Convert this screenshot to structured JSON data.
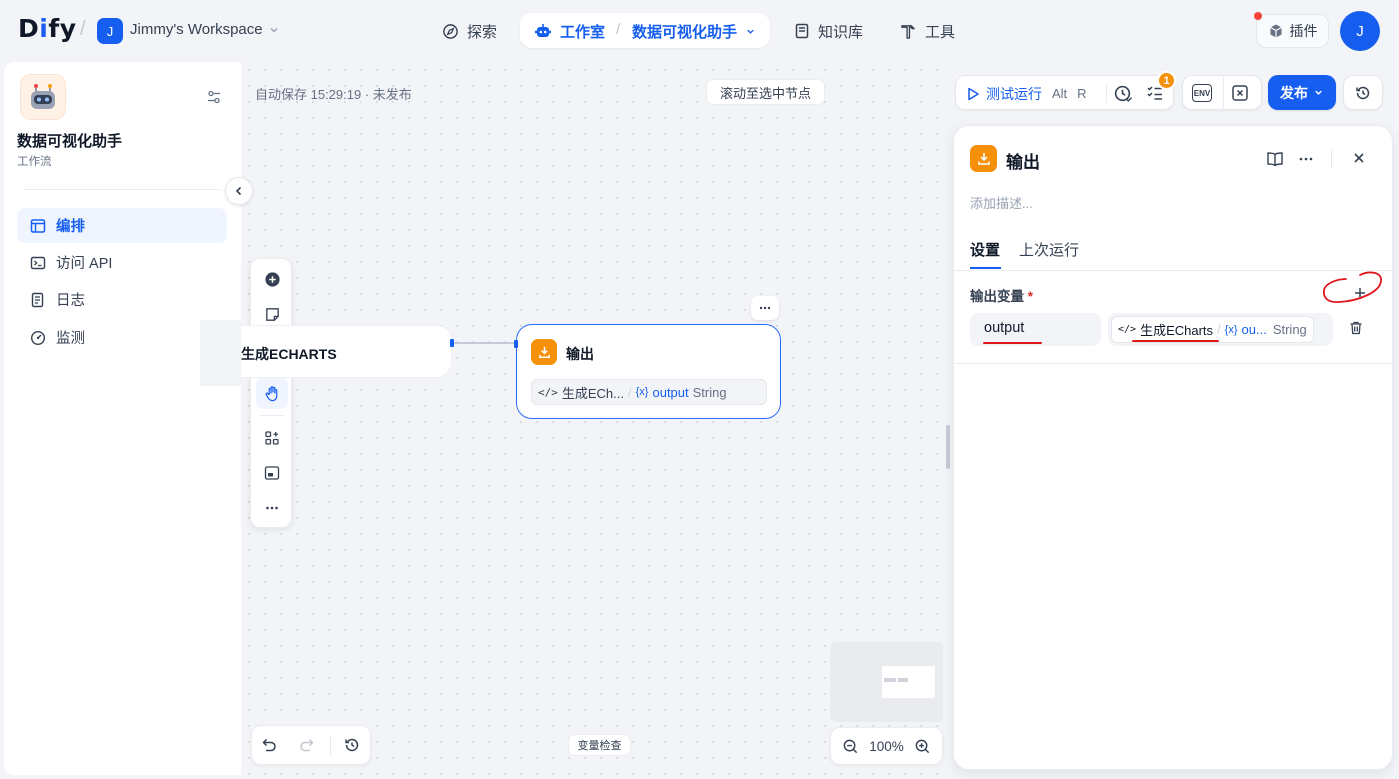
{
  "header": {
    "logo_prefix": "D",
    "logo_mid": "i",
    "logo_suffix": "fy",
    "workspace_initial": "J",
    "workspace_name": "Jimmy's Workspace",
    "nav_explore": "探索",
    "nav_studio": "工作室",
    "nav_app": "数据可视化助手",
    "nav_knowledge": "知识库",
    "nav_tools": "工具",
    "plugins_label": "插件",
    "user_initial": "J",
    "brand_color": "#155eef"
  },
  "sidebar": {
    "app_name": "数据可视化助手",
    "app_type": "工作流",
    "items": [
      {
        "label": "编排",
        "icon": "layout-icon",
        "active": true
      },
      {
        "label": "访问 API",
        "icon": "terminal-icon",
        "active": false
      },
      {
        "label": "日志",
        "icon": "file-list-icon",
        "active": false
      },
      {
        "label": "监测",
        "icon": "dashboard-gauge-icon",
        "active": false
      }
    ]
  },
  "canvas": {
    "autosave": "自动保存 15:29:19 · 未发布",
    "scroll_to_node": "滚动至选中节点",
    "prev_node_title": "生成ECHARTS",
    "output_node": {
      "title": "输出",
      "var_source": "生成ECh...",
      "var_name": "output",
      "var_type": "String"
    },
    "zoom": "100%",
    "var_inspect": "变量检查"
  },
  "toolbar": {
    "test_run": "测试运行",
    "shortcut_alt": "Alt",
    "shortcut_key": "R",
    "checklist_badge": "1",
    "env": "ENV",
    "publish": "发布"
  },
  "panel": {
    "title": "输出",
    "desc_placeholder": "添加描述...",
    "tab_settings": "设置",
    "tab_last_run": "上次运行",
    "section_label": "输出变量",
    "required_mark": "*",
    "var_name_value": "output",
    "var_source_node": "生成ECharts",
    "var_source_var": "ou...",
    "var_type": "String",
    "annotation_color": "#e0161d"
  }
}
